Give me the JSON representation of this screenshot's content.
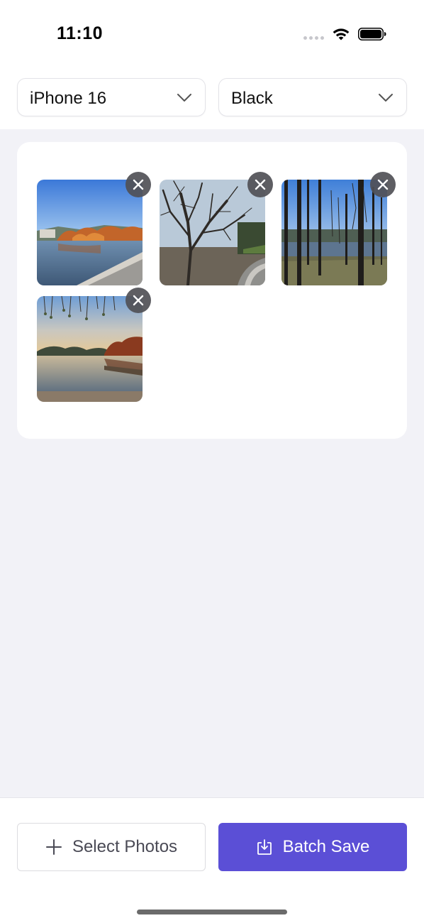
{
  "status_bar": {
    "time": "11:10",
    "icons": [
      "cellular-dots-icon",
      "wifi-icon",
      "battery-icon"
    ]
  },
  "selectors": {
    "model": {
      "value": "iPhone 16",
      "icon": "chevron-down-icon"
    },
    "color": {
      "value": "Black",
      "icon": "chevron-down-icon"
    }
  },
  "photos": [
    {
      "description_icon": "lake-pier-autumn-photo",
      "remove_icon": "close-icon"
    },
    {
      "description_icon": "bare-tree-path-photo",
      "remove_icon": "close-icon"
    },
    {
      "description_icon": "tall-trees-lake-photo",
      "remove_icon": "close-icon"
    },
    {
      "description_icon": "sunset-lake-willow-photo",
      "remove_icon": "close-icon"
    }
  ],
  "actions": {
    "select_photos_label": "Select Photos",
    "select_photos_icon": "plus-icon",
    "batch_save_label": "Batch Save",
    "batch_save_icon": "download-tray-icon"
  },
  "colors": {
    "accent": "#5b4fd6",
    "background": "#f2f2f7",
    "card": "#ffffff"
  }
}
